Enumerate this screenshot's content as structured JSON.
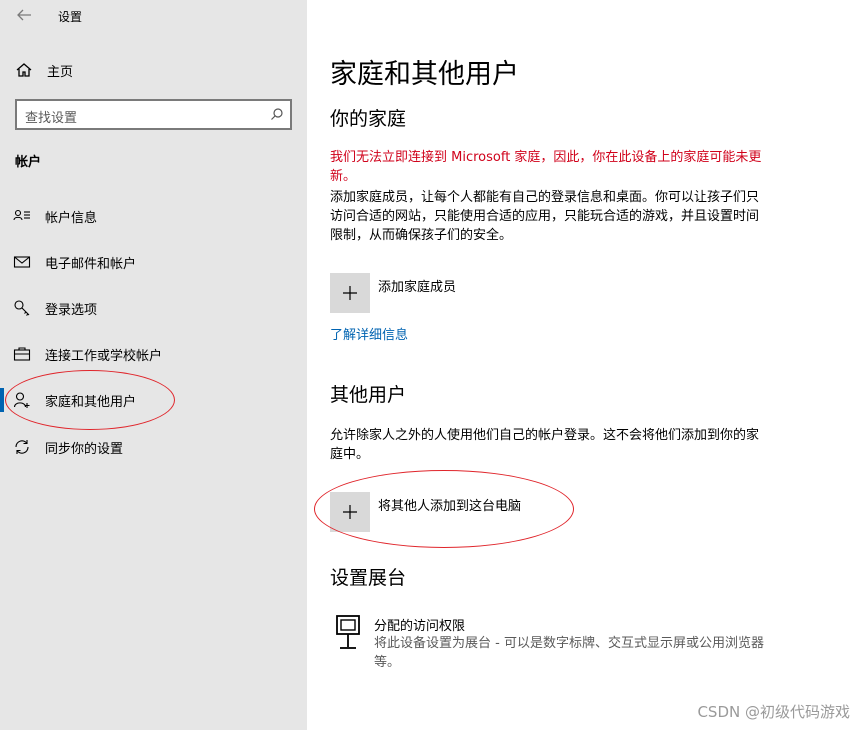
{
  "sidebar": {
    "app_title": "设置",
    "home_label": "主页",
    "search_placeholder": "查找设置",
    "section_title": "帐户",
    "items": [
      {
        "label": "帐户信息"
      },
      {
        "label": "电子邮件和帐户"
      },
      {
        "label": "登录选项"
      },
      {
        "label": "连接工作或学校帐户"
      },
      {
        "label": "家庭和其他用户",
        "active": true
      },
      {
        "label": "同步你的设置"
      }
    ]
  },
  "main": {
    "page_title": "家庭和其他用户",
    "family": {
      "heading": "你的家庭",
      "warning": "我们无法立即连接到 Microsoft 家庭，因此，你在此设备上的家庭可能未更新。",
      "description": "添加家庭成员，让每个人都能有自己的登录信息和桌面。你可以让孩子们只访问合适的网站，只能使用合适的应用，只能玩合适的游戏，并且设置时间限制，从而确保孩子们的安全。",
      "add_label": "添加家庭成员",
      "learn_more": "了解详细信息"
    },
    "others": {
      "heading": "其他用户",
      "description": "允许除家人之外的人使用他们自己的帐户登录。这不会将他们添加到你的家庭中。",
      "add_label": "将其他人添加到这台电脑"
    },
    "kiosk": {
      "heading": "设置展台",
      "title": "分配的访问权限",
      "description": "将此设备设置为展台 - 可以是数字标牌、交互式显示屏或公用浏览器等。"
    }
  },
  "watermark": "CSDN @初级代码游戏",
  "colors": {
    "sidebar_bg": "#e6e6e6",
    "accent": "#0063b1",
    "warning": "#d0021b",
    "annotation": "#e0252b"
  }
}
